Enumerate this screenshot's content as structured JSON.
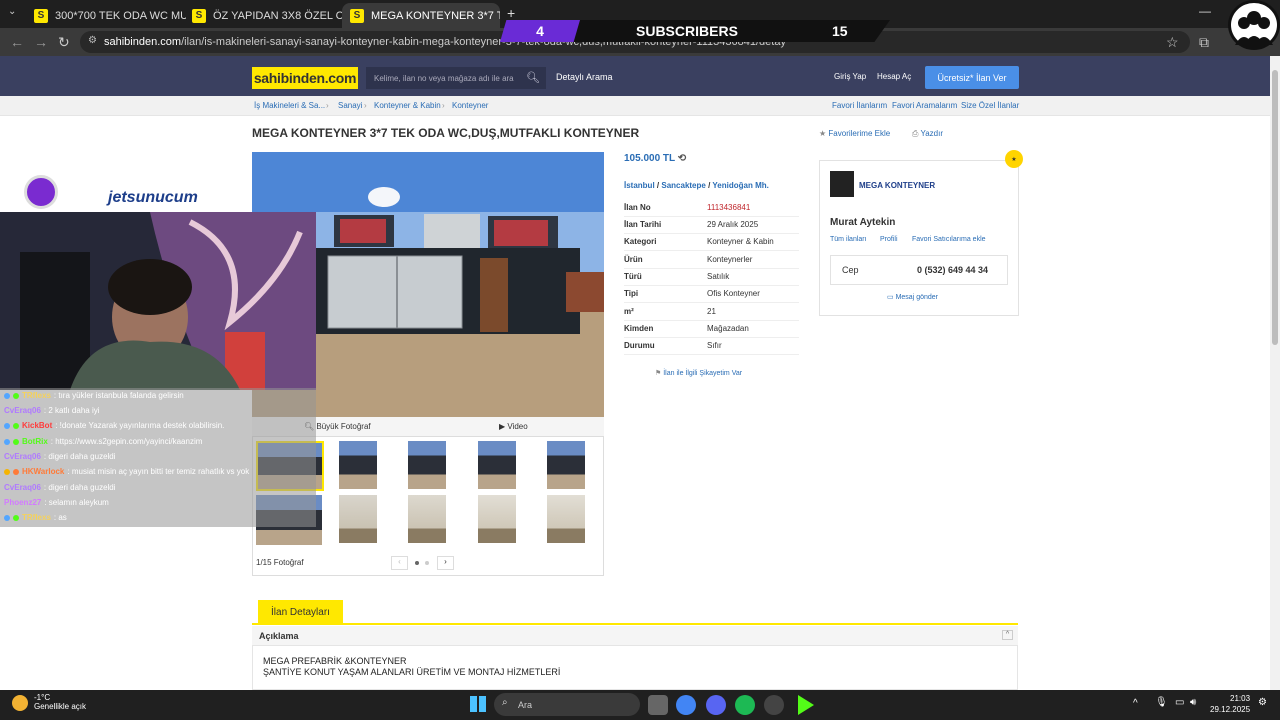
{
  "browser": {
    "tabs": [
      {
        "title": "300*700 TEK ODA WC MUTFAK ..."
      },
      {
        "title": "ÖZ YAPIDAN 3X8 ÖZEL CAMLI ..."
      },
      {
        "title": "MEGA KONTEYNER 3*7 TEK OD..."
      }
    ],
    "new_tab": "+",
    "url_domain": "sahibinden.com",
    "url_path": "/ilan/is-makineleri-sanayi-sanayi-konteyner-kabin-mega-konteyner-3-7-tek-oda-wc,dus,mutfakli-konteyner-1113436841/detay"
  },
  "overlay": {
    "sub_count": "4",
    "sub_label": "SUBSCRIBERS",
    "sub_goal": "15",
    "sponsor": "jetsunucum"
  },
  "header": {
    "logo": "sahibinden.com",
    "search_placeholder": "Kelime, ilan no veya mağaza adı ile ara",
    "advanced": "Detaylı Arama",
    "login": "Giriş Yap",
    "signup": "Hesap Aç",
    "post_ad": "Ücretsiz* İlan Ver"
  },
  "breadcrumb": {
    "items": [
      "İş Makineleri & Sa...",
      "Sanayi",
      "Konteyner & Kabin",
      "Konteyner"
    ],
    "right": [
      "Favori İlanlarım",
      "Favori Aramalarım",
      "Size Özel İlanlar"
    ]
  },
  "listing": {
    "title": "MEGA KONTEYNER 3*7 TEK ODA WC,DUŞ,MUTFAKLI KONTEYNER",
    "favorite": "Favorilerime Ekle",
    "print": "Yazdır",
    "big_photo": "Büyük Fotoğraf",
    "video": "Video",
    "photo_count": "1/15 Fotoğraf",
    "price": "105.000 TL",
    "location": [
      "İstanbul",
      "Sancaktepe",
      "Yenidoğan Mh."
    ],
    "info": [
      {
        "k": "İlan No",
        "v": "1113436841"
      },
      {
        "k": "İlan Tarihi",
        "v": "29 Aralık 2025"
      },
      {
        "k": "Kategori",
        "v": "Konteyner & Kabin"
      },
      {
        "k": "Ürün",
        "v": "Konteynerler"
      },
      {
        "k": "Türü",
        "v": "Satılık"
      },
      {
        "k": "Tipi",
        "v": "Ofis Konteyner"
      },
      {
        "k": "m²",
        "v": "21"
      },
      {
        "k": "Kimden",
        "v": "Mağazadan"
      },
      {
        "k": "Durumu",
        "v": "Sıfır"
      }
    ],
    "complain": "İlan ile İlgili Şikayetim Var"
  },
  "seller": {
    "store": "MEGA KONTEYNER",
    "name": "Murat Aytekin",
    "links": [
      "Tüm ilanları",
      "Profili",
      "Favori Satıcılarıma ekle"
    ],
    "phone_label": "Cep",
    "phone": "0 (532) 649 44 34",
    "message": "Mesaj gönder"
  },
  "chat": [
    {
      "user": "TRflexs",
      "msg": ": tıra yükler istanbula falanda gelirsin",
      "color": "#f5d25b"
    },
    {
      "user": "CvEraq06",
      "msg": ": 2 katlı daha iyi",
      "color": "#b07aff"
    },
    {
      "user": "KickBot",
      "msg": ": !donate Yazarak yayınlarıma destek olabilirsin.",
      "color": "#ff3b3b"
    },
    {
      "user": "BotRix",
      "msg": ": https://www.s2gepin.com/yayinci/kaanzim",
      "color": "#53fc18"
    },
    {
      "user": "CvEraq06",
      "msg": ": digeri daha guzeldi",
      "color": "#b07aff"
    },
    {
      "user": "HKWarlock",
      "msg": ": musiat misin aç yayın bitti ter temiz rahatlık vs yok",
      "color": "#ff7b39"
    },
    {
      "user": "CvEraq06",
      "msg": ": digeri daha guzeldi",
      "color": "#b07aff"
    },
    {
      "user": "Phoenz27",
      "msg": ": selamın aleykum",
      "color": "#d27bff"
    },
    {
      "user": "TRflexs",
      "msg": ": as",
      "color": "#f5d25b"
    }
  ],
  "details": {
    "tab": "İlan Detayları",
    "heading": "Açıklama",
    "line1": "MEGA PREFABRİK &KONTEYNER",
    "line2": "ŞANTİYE KONUT YAŞAM ALANLARI ÜRETİM VE MONTAJ HİZMETLERİ"
  },
  "taskbar": {
    "temp": "-1°C",
    "weather": "Genellikle açık",
    "search": "Ara",
    "time": "21:03",
    "date": "29.12.2025"
  }
}
